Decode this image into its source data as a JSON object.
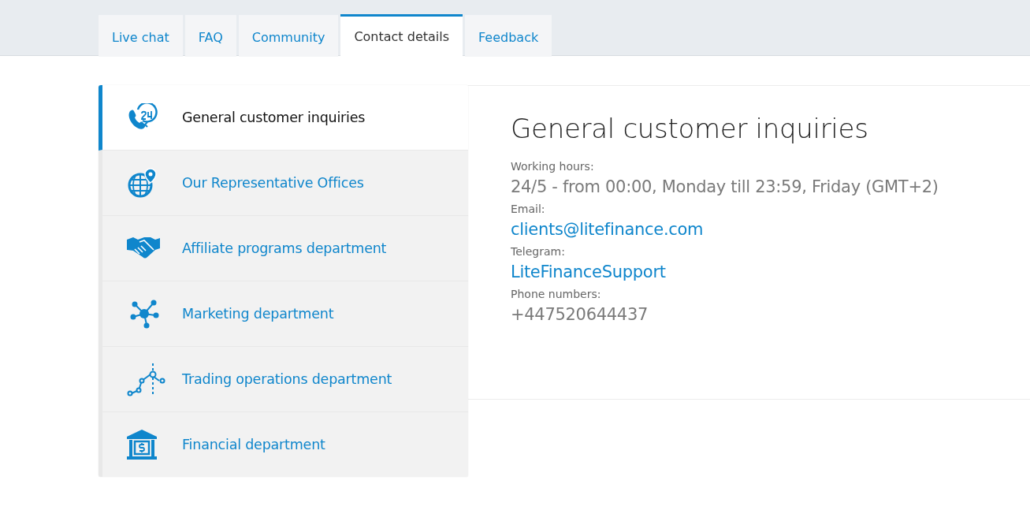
{
  "tabs": [
    {
      "label": "Live chat",
      "selected": false
    },
    {
      "label": "FAQ",
      "selected": false
    },
    {
      "label": "Community",
      "selected": false
    },
    {
      "label": "Contact details",
      "selected": true
    },
    {
      "label": "Feedback",
      "selected": false
    }
  ],
  "sidebar": {
    "items": [
      {
        "label": "General customer inquiries",
        "selected": true
      },
      {
        "label": "Our Representative Offices",
        "selected": false
      },
      {
        "label": "Affiliate programs department",
        "selected": false
      },
      {
        "label": "Marketing department",
        "selected": false
      },
      {
        "label": "Trading operations department",
        "selected": false
      },
      {
        "label": "Financial department",
        "selected": false
      }
    ]
  },
  "detail": {
    "title": "General customer inquiries",
    "fields": [
      {
        "label": "Working hours:",
        "value": "24/5 - from 00:00, Monday till 23:59, Friday (GMT+2)",
        "kind": "text"
      },
      {
        "label": "Email:",
        "value": "clients@litefinance.com",
        "kind": "link"
      },
      {
        "label": "Telegram:",
        "value": "LiteFinanceSupport",
        "kind": "link"
      },
      {
        "label": "Phone numbers:",
        "value": "+447520644437",
        "kind": "text"
      }
    ]
  }
}
